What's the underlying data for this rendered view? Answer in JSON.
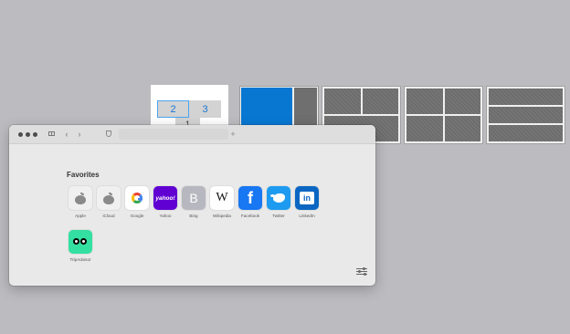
{
  "layout_picker": {
    "active_tile": {
      "zone_left": "2",
      "zone_right": "3",
      "zone_bottom": "1"
    },
    "accent_color": "#0877d2"
  },
  "window": {
    "favorites_heading": "Favorites",
    "favorites": [
      {
        "label": "Apple",
        "icon": "apple-icon"
      },
      {
        "label": "iCloud",
        "icon": "apple-icon"
      },
      {
        "label": "Google",
        "icon": "google-icon"
      },
      {
        "label": "Yahoo",
        "icon": "yahoo-icon",
        "glyph": "yahoo!"
      },
      {
        "label": "Bing",
        "icon": "bing-icon",
        "glyph": "B"
      },
      {
        "label": "Wikipedia",
        "icon": "wikipedia-icon",
        "glyph": "W"
      },
      {
        "label": "Facebook",
        "icon": "facebook-icon",
        "glyph": "f"
      },
      {
        "label": "Twitter",
        "icon": "twitter-icon"
      },
      {
        "label": "LinkedIn",
        "icon": "linkedin-icon",
        "glyph": "in"
      },
      {
        "label": "TripAdvisor",
        "icon": "tripadvisor-icon"
      }
    ],
    "toolbar": {
      "back_glyph": "‹",
      "forward_glyph": "›",
      "new_tab_glyph": "+"
    }
  }
}
